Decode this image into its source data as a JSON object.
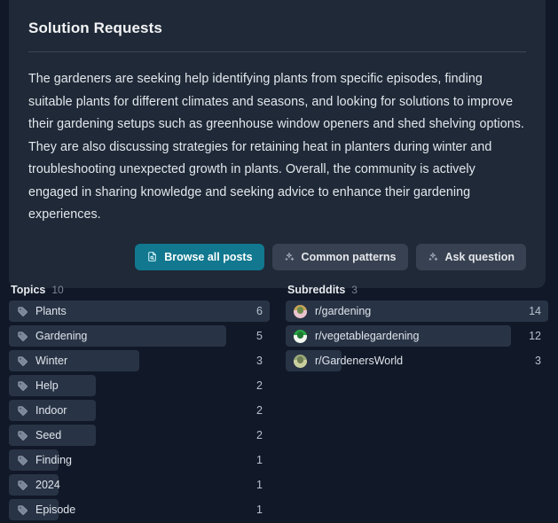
{
  "card": {
    "title": "Solution Requests",
    "body": "The gardeners are seeking help identifying plants from specific episodes, finding suitable plants for different climates and seasons, and looking for solutions to improve their gardening setups such as greenhouse window openers and shed shelving options. They are also discussing strategies for retaining heat in planters during winter and troubleshooting unexpected growth in plants. Overall, the community is actively engaged in sharing knowledge and seeking advice to enhance their gardening experiences.",
    "actions": [
      {
        "label": "Browse all posts",
        "icon": "file-search-icon",
        "style": "primary"
      },
      {
        "label": "Common patterns",
        "icon": "sparkles-icon",
        "style": "secondary"
      },
      {
        "label": "Ask question",
        "icon": "sparkles-icon",
        "style": "secondary"
      }
    ]
  },
  "topics": {
    "label": "Topics",
    "count": "10",
    "icon": "tag-icon",
    "max": 6,
    "items": [
      {
        "label": "Plants",
        "value": "6"
      },
      {
        "label": "Gardening",
        "value": "5"
      },
      {
        "label": "Winter",
        "value": "3"
      },
      {
        "label": "Help",
        "value": "2"
      },
      {
        "label": "Indoor",
        "value": "2"
      },
      {
        "label": "Seed",
        "value": "2"
      },
      {
        "label": "Finding",
        "value": "1"
      },
      {
        "label": "2024",
        "value": "1"
      },
      {
        "label": "Episode",
        "value": "1"
      }
    ]
  },
  "subreddits": {
    "label": "Subreddits",
    "count": "3",
    "max": 14,
    "items": [
      {
        "label": "r/gardening",
        "value": "14",
        "avatar": "subreddit-avatar-gardening",
        "colors": [
          "#c8a35a",
          "#e9c3cf",
          "#6d8a4a"
        ]
      },
      {
        "label": "r/vegetablegardening",
        "value": "12",
        "avatar": "subreddit-avatar-vegetablegardening",
        "colors": [
          "#28a745",
          "#f2f5f0",
          "#1e7a33"
        ]
      },
      {
        "label": "r/GardenersWorld",
        "value": "3",
        "avatar": "subreddit-avatar-gardenersworld",
        "colors": [
          "#9aa87a",
          "#c9cf9e",
          "#6f7f55"
        ]
      }
    ]
  },
  "theme": {
    "page_bg": "#111827",
    "card_bg": "#1f2937",
    "bar_bg": "#283445",
    "primary": "#11788f",
    "secondary": "#374151"
  }
}
